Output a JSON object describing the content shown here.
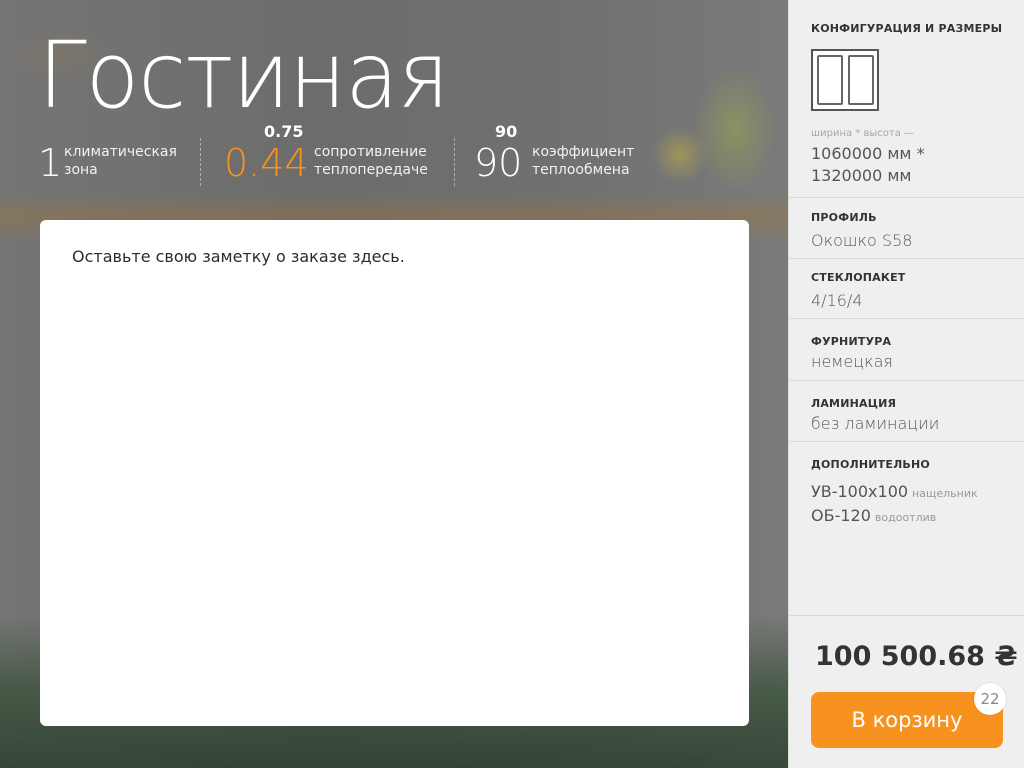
{
  "room_title": "Гостиная",
  "stats": {
    "climate": {
      "value": "1",
      "label_line1": "климатическая",
      "label_line2": "зона"
    },
    "resistance": {
      "value": "0.44",
      "target": "0.75",
      "label_line1": "сопротивление",
      "label_line2": "теплопередаче",
      "value_color": "#f7921e"
    },
    "coefficient": {
      "value": "90",
      "target": "90",
      "label_line1": "коэффициент",
      "label_line2": "теплообмена"
    }
  },
  "note": {
    "placeholder": "Оставьте свою заметку о заказе здесь."
  },
  "panel": {
    "config": {
      "title": "КОНФИГУРАЦИЯ И РАЗМЕРЫ",
      "icon": "double-window-icon",
      "dims_label": "ширина * высота —",
      "dims_line1": "1060000 мм *",
      "dims_line2": "1320000 мм"
    },
    "profile": {
      "title": "ПРОФИЛЬ",
      "value": "Окошко S58"
    },
    "glass": {
      "title": "СТЕКЛОПАКЕТ",
      "value": "4/16/4"
    },
    "hardware": {
      "title": "ФУРНИТУРА",
      "value": "немецкая"
    },
    "lamination": {
      "title": "ЛАМИНАЦИЯ",
      "value": "без ламинации"
    },
    "extra": {
      "title": "ДОПОЛНИТЕЛЬНО",
      "items": [
        {
          "code": "УВ-100х100",
          "hint": "нащельник"
        },
        {
          "code": "ОБ-120",
          "hint": "водоотлив"
        }
      ]
    },
    "price": "100 500.68 ₴",
    "cart_button": "В корзину",
    "cart_count": "22",
    "accent_color": "#f7921e"
  }
}
